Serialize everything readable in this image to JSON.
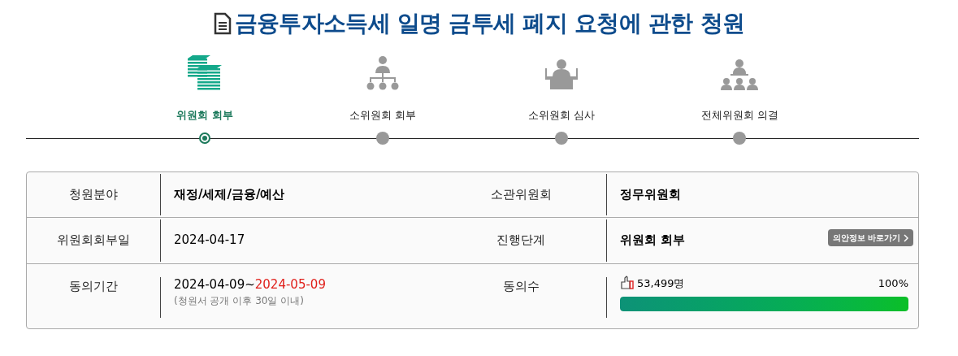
{
  "title": "금융투자소득세 일명 금투세 폐지 요청에 관한 청원",
  "steps": [
    {
      "label": "위원회 회부",
      "kind": "documents",
      "selected": true
    },
    {
      "label": "소위원회 회부",
      "kind": "hierarchy",
      "selected": false
    },
    {
      "label": "소위원회 심사",
      "kind": "podium",
      "selected": false
    },
    {
      "label": "전체위원회 의결",
      "kind": "assembly",
      "selected": false
    }
  ],
  "info": {
    "field_label": "청원분야",
    "field_value": "재정/세제/금융/예산",
    "committee_label": "소관위원회",
    "committee_value": "정무위원회",
    "referral_date_label": "위원회회부일",
    "referral_date_value": "2024-04-17",
    "stage_label": "진행단계",
    "stage_value": "위원회 회부",
    "bill_info_button": "의안정보 바로가기",
    "period_label": "동의기간",
    "period_start": "2024-04-09~",
    "period_end": "2024-05-09",
    "period_note": "(청원서 공개 이후 30일 이내)",
    "consent_label": "동의수",
    "consent_count": "53,499명",
    "consent_percent": "100%",
    "level": 1
  }
}
